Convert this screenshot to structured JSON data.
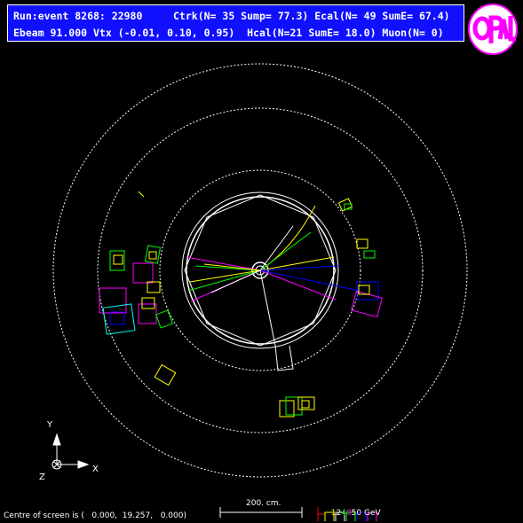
{
  "header": {
    "line1": "Run:event 8268: 22980     Ctrk(N= 35 Sump= 77.3) Ecal(N= 49 SumE= 67.4)",
    "line2": "Ebeam 91.000 Vtx (-0.01, 0.10, 0.95)  Hcal(N=21 SumE= 18.0) Muon(N= 0)"
  },
  "logo": {
    "text": "OPAL",
    "colors": {
      "ring": "#ff00ff",
      "letters": "#ff00ff",
      "bg": "#ffffff"
    }
  },
  "axes": {
    "y": "Y",
    "x": "X",
    "z": "Z"
  },
  "footer": {
    "centre_text": "Centre of screen is (   0.000,  19.257,   0.000)",
    "scale_label": "200. cm.",
    "energy_ticks": [
      "1",
      "2",
      "4",
      "8",
      "50 GeV"
    ],
    "energy_colors": [
      "#ffff00",
      "#ffffff",
      "#00ff00",
      "#0000ff",
      "#ff00ff",
      "#ff0000"
    ]
  },
  "colors": {
    "background": "#000000",
    "header_bg": "#1010ff",
    "detector": "#ffffff"
  }
}
